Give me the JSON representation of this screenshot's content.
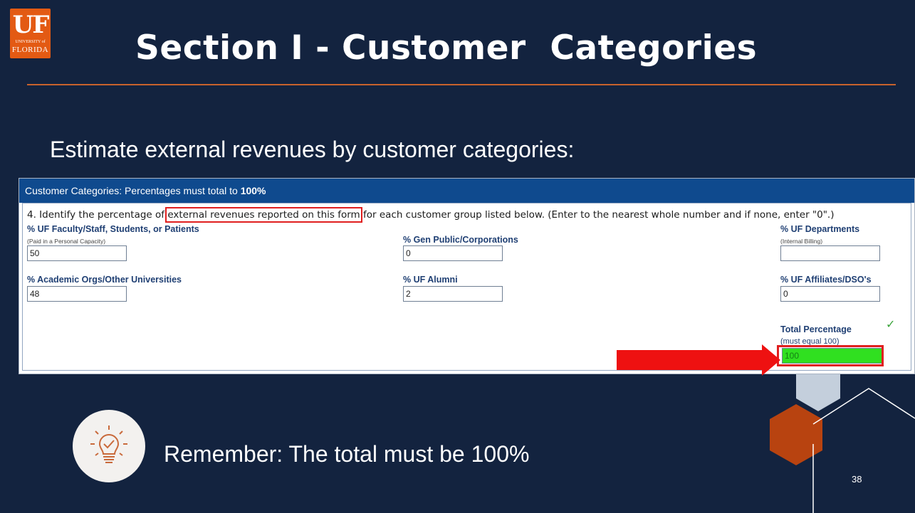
{
  "logo": {
    "big": "UF",
    "small": "UNIVERSITY of",
    "bottom": "FLORIDA"
  },
  "title": "Section I - Customer  Categories",
  "subtitle": "Estimate external revenues by customer categories:",
  "form": {
    "header_prefix": "Customer Categories: Percentages must total to ",
    "header_bold": "100%",
    "question_prefix": "4. Identify the percentage of ",
    "question_highlight": "external revenues reported on this form",
    "question_suffix": " for each customer group listed below. (Enter to the nearest whole number and if none, enter \"0\".)",
    "fields": {
      "faculty": {
        "label": "% UF Faculty/Staff, Students, or Patients",
        "note": "(Paid in a Personal Capacity)",
        "value": "50"
      },
      "gen_public": {
        "label": "% Gen Public/Corporations",
        "value": "0"
      },
      "departments": {
        "label": "% UF Departments",
        "note": "(Internal Billing)",
        "value": ""
      },
      "academic": {
        "label": "% Academic Orgs/Other Universities",
        "value": "48"
      },
      "alumni": {
        "label": "% UF Alumni",
        "value": "2"
      },
      "affiliates": {
        "label": "% UF Affiliates/DSO's",
        "value": "0"
      },
      "total": {
        "label": "Total Percentage",
        "note": "(must equal 100)",
        "value": "100"
      }
    }
  },
  "reminder": {
    "bold": "Remember:",
    "text": " The total must be 100%"
  },
  "page_number": "38",
  "colors": {
    "background": "#13233f",
    "accent": "#c8622c",
    "form_header": "#0f4a8e",
    "highlight": "#e01f1f",
    "total_fill": "#30e020"
  }
}
